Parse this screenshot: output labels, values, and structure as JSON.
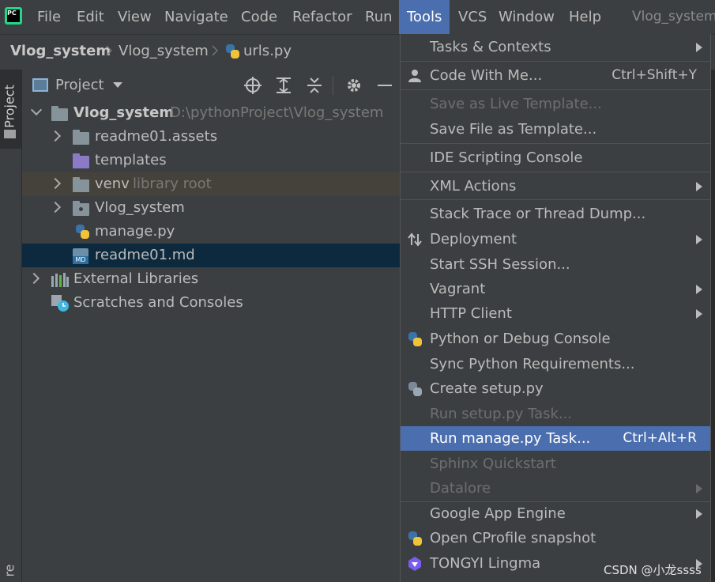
{
  "menubar": {
    "logo_text": "PC",
    "items": [
      "File",
      "Edit",
      "View",
      "Navigate",
      "Code",
      "Refactor",
      "Run",
      "Tools",
      "VCS",
      "Window",
      "Help"
    ],
    "window_title": "Vlog_system"
  },
  "breadcrumb": [
    "Vlog_system",
    "Vlog_system",
    "urls.py"
  ],
  "side_tab": {
    "label": "Project",
    "bottom_label": "re"
  },
  "project_panel": {
    "title": "Project",
    "tree": [
      {
        "label": "Vlog_system",
        "sub": "D:\\pythonProject\\Vlog_system"
      },
      {
        "label": "readme01.assets"
      },
      {
        "label": "templates"
      },
      {
        "label": "venv",
        "sub": "library root"
      },
      {
        "label": "Vlog_system"
      },
      {
        "label": "manage.py"
      },
      {
        "label": "readme01.md"
      },
      {
        "label": "External Libraries"
      },
      {
        "label": "Scratches and Consoles"
      }
    ]
  },
  "tools_menu": {
    "items": [
      {
        "label": "Tasks & Contexts",
        "submenu": true
      },
      {
        "label": "Code With Me...",
        "shortcut": "Ctrl+Shift+Y"
      },
      {
        "label": "Save as Live Template...",
        "disabled": true
      },
      {
        "label": "Save File as Template..."
      },
      {
        "label": "IDE Scripting Console"
      },
      {
        "label": "XML Actions",
        "submenu": true
      },
      {
        "label": "Stack Trace or Thread Dump..."
      },
      {
        "label": "Deployment",
        "submenu": true
      },
      {
        "label": "Start SSH Session..."
      },
      {
        "label": "Vagrant",
        "submenu": true
      },
      {
        "label": "HTTP Client",
        "submenu": true
      },
      {
        "label": "Python or Debug Console"
      },
      {
        "label": "Sync Python Requirements..."
      },
      {
        "label": "Create setup.py"
      },
      {
        "label": "Run setup.py Task...",
        "disabled": true
      },
      {
        "label": "Run manage.py Task...",
        "shortcut": "Ctrl+Alt+R",
        "highlighted": true
      },
      {
        "label": "Sphinx Quickstart",
        "disabled": true
      },
      {
        "label": "Datalore",
        "disabled": true,
        "submenu": true
      },
      {
        "label": "Google App Engine",
        "submenu": true
      },
      {
        "label": "Open CProfile snapshot"
      },
      {
        "label": "TONGYI Lingma",
        "submenu": true
      }
    ]
  },
  "watermark": "CSDN @小龙ssss"
}
